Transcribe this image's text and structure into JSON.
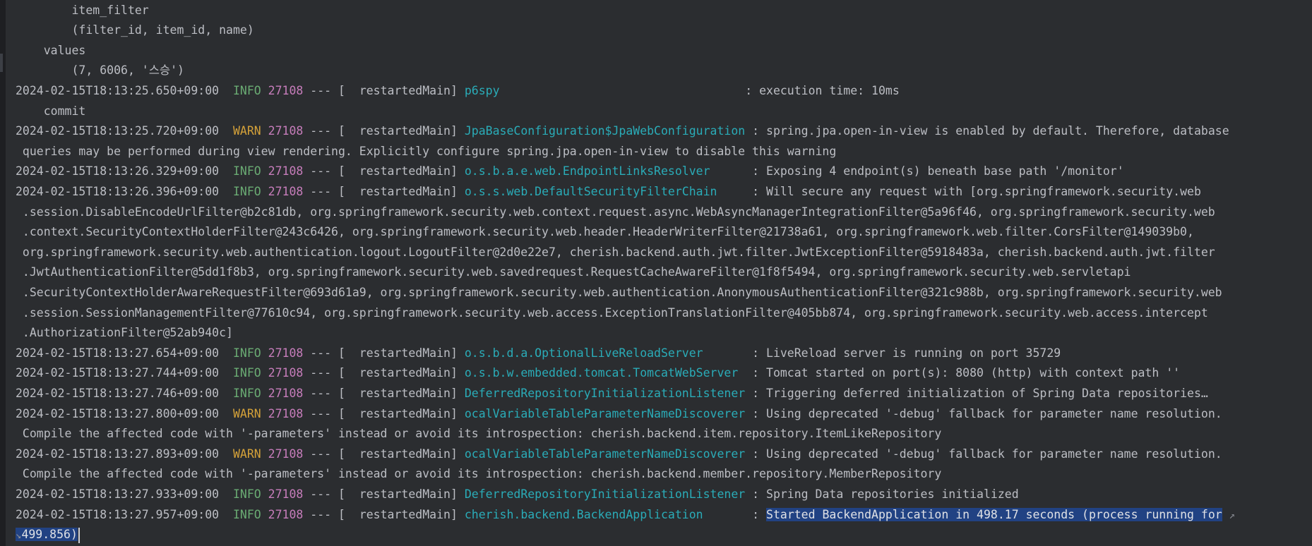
{
  "console": {
    "lines": [
      {
        "kind": "plain",
        "text": "        item_filter"
      },
      {
        "kind": "plain",
        "text": "        (filter_id, item_id, name)"
      },
      {
        "kind": "plain",
        "text": "    values"
      },
      {
        "kind": "plain",
        "text": "        (7, 6006, '스승')"
      },
      {
        "kind": "log",
        "ts": "2024-02-15T18:13:25.650+09:00",
        "level": "INFO",
        "pid": "27108",
        "sep": "---",
        "thread": "[  restartedMain]",
        "logger": "p6spy                                  ",
        "message": ": execution time: 10ms"
      },
      {
        "kind": "plain",
        "text": "    commit"
      },
      {
        "kind": "log",
        "ts": "2024-02-15T18:13:25.720+09:00",
        "level": "WARN",
        "pid": "27108",
        "sep": "---",
        "thread": "[  restartedMain]",
        "logger": "JpaBaseConfiguration$JpaWebConfiguration",
        "message": ": spring.jpa.open-in-view is enabled by default. Therefore, database"
      },
      {
        "kind": "plain",
        "text": " queries may be performed during view rendering. Explicitly configure spring.jpa.open-in-view to disable this warning"
      },
      {
        "kind": "log",
        "ts": "2024-02-15T18:13:26.329+09:00",
        "level": "INFO",
        "pid": "27108",
        "sep": "---",
        "thread": "[  restartedMain]",
        "logger": "o.s.b.a.e.web.EndpointLinksResolver     ",
        "message": ": Exposing 4 endpoint(s) beneath base path '/monitor'"
      },
      {
        "kind": "log",
        "ts": "2024-02-15T18:13:26.396+09:00",
        "level": "INFO",
        "pid": "27108",
        "sep": "---",
        "thread": "[  restartedMain]",
        "logger": "o.s.s.web.DefaultSecurityFilterChain    ",
        "message": ": Will secure any request with [org.springframework.security.web"
      },
      {
        "kind": "plain",
        "text": " .session.DisableEncodeUrlFilter@b2c81db, org.springframework.security.web.context.request.async.WebAsyncManagerIntegrationFilter@5a96f46, org.springframework.security.web"
      },
      {
        "kind": "plain",
        "text": " .context.SecurityContextHolderFilter@243c6426, org.springframework.security.web.header.HeaderWriterFilter@21738a61, org.springframework.web.filter.CorsFilter@149039b0,"
      },
      {
        "kind": "plain",
        "text": " org.springframework.security.web.authentication.logout.LogoutFilter@2d0e22e7, cherish.backend.auth.jwt.filter.JwtExceptionFilter@5918483a, cherish.backend.auth.jwt.filter"
      },
      {
        "kind": "plain",
        "text": " .JwtAuthenticationFilter@5dd1f8b3, org.springframework.security.web.savedrequest.RequestCacheAwareFilter@1f8f5494, org.springframework.security.web.servletapi"
      },
      {
        "kind": "plain",
        "text": " .SecurityContextHolderAwareRequestFilter@693d61a9, org.springframework.security.web.authentication.AnonymousAuthenticationFilter@321c988b, org.springframework.security.web"
      },
      {
        "kind": "plain",
        "text": " .session.SessionManagementFilter@77610c94, org.springframework.security.web.access.ExceptionTranslationFilter@405bb874, org.springframework.security.web.access.intercept"
      },
      {
        "kind": "plain",
        "text": " .AuthorizationFilter@52ab940c]"
      },
      {
        "kind": "log",
        "ts": "2024-02-15T18:13:27.654+09:00",
        "level": "INFO",
        "pid": "27108",
        "sep": "---",
        "thread": "[  restartedMain]",
        "logger": "o.s.b.d.a.OptionalLiveReloadServer      ",
        "message": ": LiveReload server is running on port 35729"
      },
      {
        "kind": "log",
        "ts": "2024-02-15T18:13:27.744+09:00",
        "level": "INFO",
        "pid": "27108",
        "sep": "---",
        "thread": "[  restartedMain]",
        "logger": "o.s.b.w.embedded.tomcat.TomcatWebServer ",
        "message": ": Tomcat started on port(s): 8080 (http) with context path ''"
      },
      {
        "kind": "log",
        "ts": "2024-02-15T18:13:27.746+09:00",
        "level": "INFO",
        "pid": "27108",
        "sep": "---",
        "thread": "[  restartedMain]",
        "logger": "DeferredRepositoryInitializationListener",
        "message": ": Triggering deferred initialization of Spring Data repositories…"
      },
      {
        "kind": "log",
        "ts": "2024-02-15T18:13:27.800+09:00",
        "level": "WARN",
        "pid": "27108",
        "sep": "---",
        "thread": "[  restartedMain]",
        "logger": "ocalVariableTableParameterNameDiscoverer",
        "message": ": Using deprecated '-debug' fallback for parameter name resolution."
      },
      {
        "kind": "plain",
        "text": " Compile the affected code with '-parameters' instead or avoid its introspection: cherish.backend.item.repository.ItemLikeRepository"
      },
      {
        "kind": "log",
        "ts": "2024-02-15T18:13:27.893+09:00",
        "level": "WARN",
        "pid": "27108",
        "sep": "---",
        "thread": "[  restartedMain]",
        "logger": "ocalVariableTableParameterNameDiscoverer",
        "message": ": Using deprecated '-debug' fallback for parameter name resolution."
      },
      {
        "kind": "plain",
        "text": " Compile the affected code with '-parameters' instead or avoid its introspection: cherish.backend.member.repository.MemberRepository"
      },
      {
        "kind": "log",
        "ts": "2024-02-15T18:13:27.933+09:00",
        "level": "INFO",
        "pid": "27108",
        "sep": "---",
        "thread": "[  restartedMain]",
        "logger": "DeferredRepositoryInitializationListener",
        "message": ": Spring Data repositories initialized"
      },
      {
        "kind": "log",
        "ts": "2024-02-15T18:13:27.957+09:00",
        "level": "INFO",
        "pid": "27108",
        "sep": "---",
        "thread": "[  restartedMain]",
        "logger": "cherish.backend.BackendApplication      ",
        "message": ": ",
        "highlight": "Started BackendApplication in 498.17 seconds (process running for",
        "wrapIcon": true
      },
      {
        "kind": "plain",
        "highlightOnly": true,
        "highlight": "499.856)",
        "wrapIconStart": true,
        "caret": true
      }
    ],
    "colors": {
      "background": "#2b2d30",
      "text": "#bcbec4",
      "info": "#6aab73",
      "warn": "#d4a139",
      "pid": "#c77dbb",
      "logger": "#2aacb8",
      "selection": "#214283"
    },
    "icons": {
      "soft_wrap": "soft-wrap-icon"
    }
  }
}
